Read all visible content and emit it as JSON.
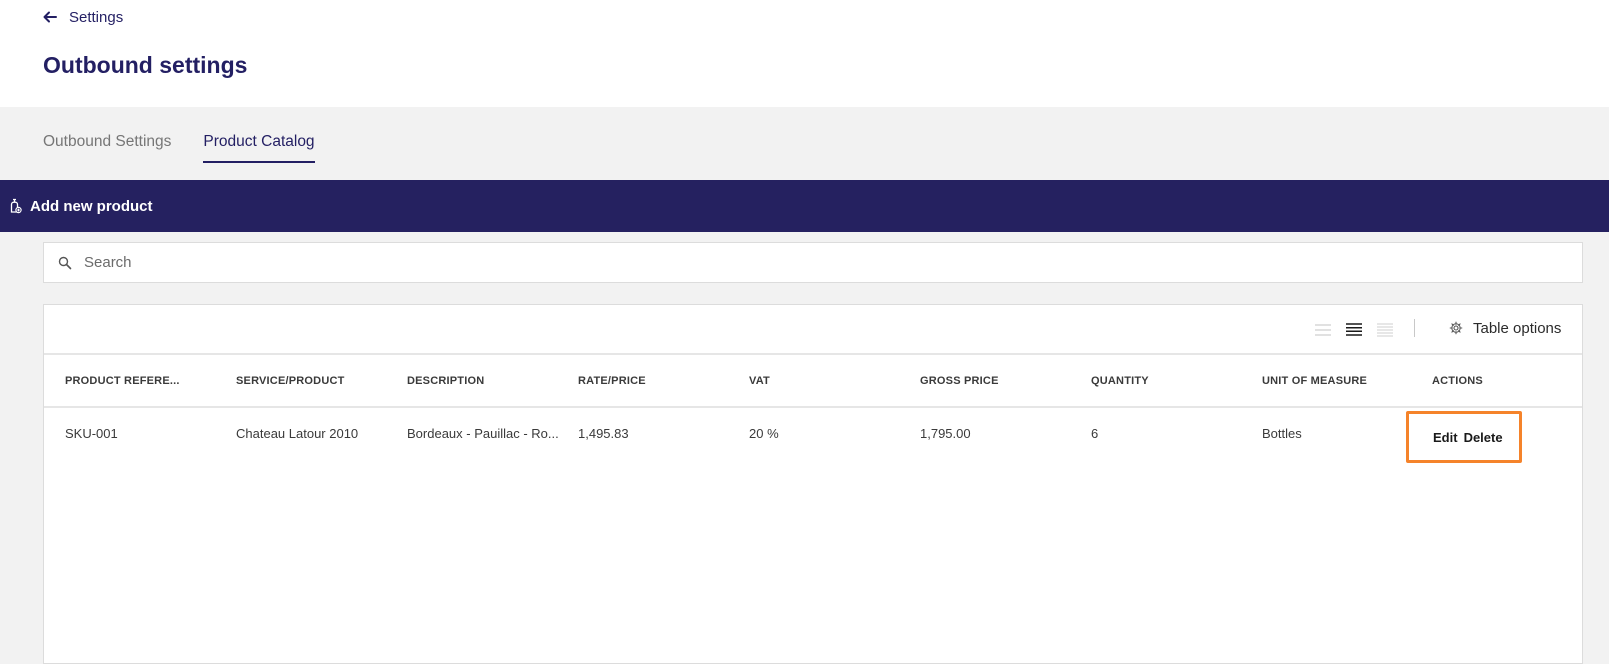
{
  "header": {
    "back_label": "Settings",
    "title": "Outbound settings"
  },
  "tabs": [
    {
      "label": "Outbound Settings",
      "active": false
    },
    {
      "label": "Product Catalog",
      "active": true
    }
  ],
  "action_bar": {
    "add_label": "Add new product"
  },
  "search": {
    "placeholder": "Search",
    "value": ""
  },
  "toolbar": {
    "table_options_label": "Table options"
  },
  "table": {
    "columns": [
      "PRODUCT REFERE...",
      "SERVICE/PRODUCT",
      "DESCRIPTION",
      "RATE/PRICE",
      "VAT",
      "GROSS PRICE",
      "QUANTITY",
      "UNIT OF MEASURE",
      "ACTIONS"
    ],
    "rows": [
      {
        "reference": "SKU-001",
        "service": "Chateau Latour 2010",
        "description": "Bordeaux - Pauillac - Ro...",
        "rate": "1,495.83",
        "vat": "20 %",
        "gross": "1,795.00",
        "quantity": "6",
        "unit": "Bottles",
        "edit_label": "Edit",
        "delete_label": "Delete"
      }
    ]
  },
  "colors": {
    "brand": "#252160",
    "title": "#231f63",
    "highlight": "#f5832a"
  }
}
